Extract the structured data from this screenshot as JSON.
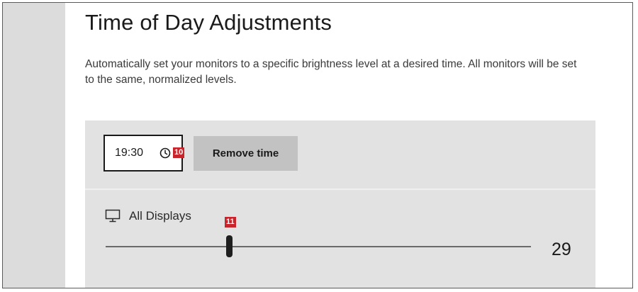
{
  "section": {
    "title": "Time of Day Adjustments",
    "description": "Automatically set your monitors to a specific brightness level at a desired time. All monitors will be set to the same, normalized levels."
  },
  "schedule": {
    "time_value": "19:30",
    "time_icon": "clock-icon",
    "remove_label": "Remove time",
    "display_icon": "monitor-icon",
    "display_label": "All Displays",
    "brightness_value": "29",
    "brightness_fraction": 0.29
  },
  "badges": {
    "time_badge": "10",
    "slider_badge": "11"
  },
  "colors": {
    "sidebar": "#dcdcdc",
    "card": "#e2e2e2",
    "button": "#c2c2c2",
    "badge": "#c8242b"
  }
}
